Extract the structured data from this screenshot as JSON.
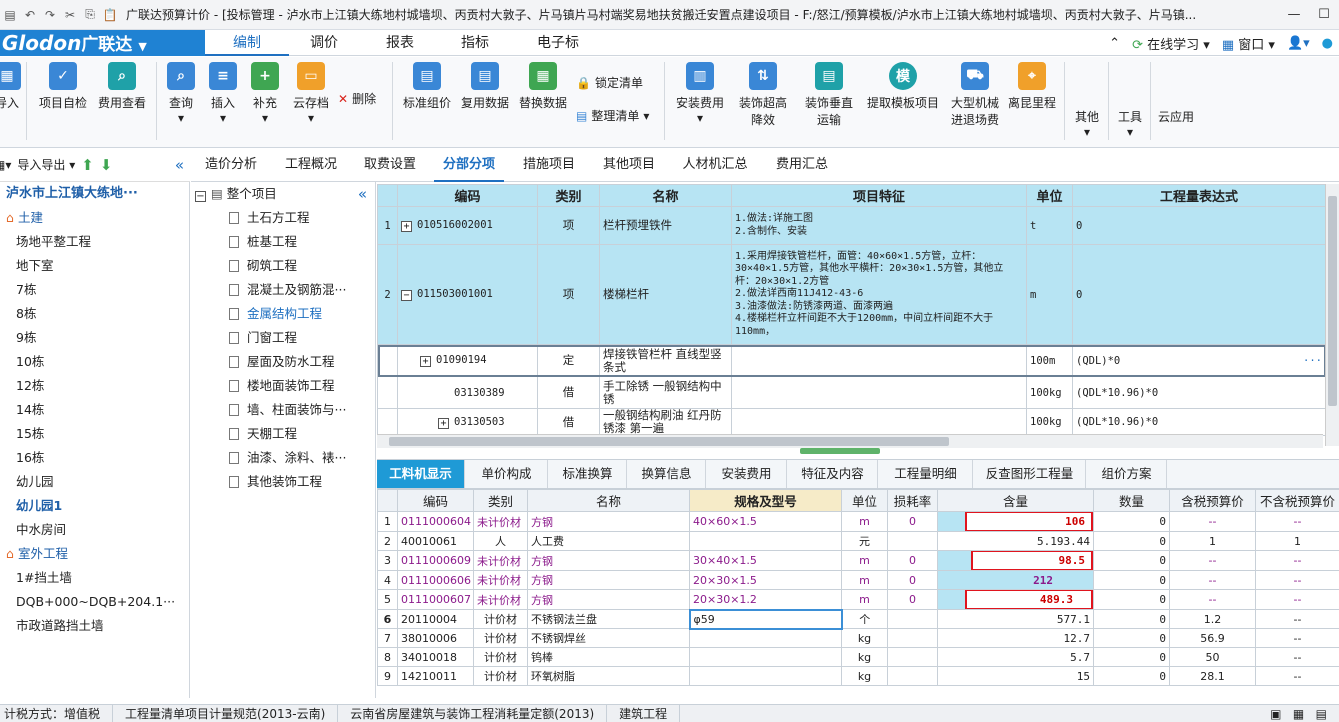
{
  "titlebar": {
    "title": "广联达预算计价 - [投标管理 - 泸水市上江镇大练地村城墙坝、丙贡村大敦子、片马镇片马村端奖易地扶贫搬迁安置点建设项目 - F:/怒江/预算模板/泸水市上江镇大练地村城墙坝、丙贡村大敦子、片马镇..."
  },
  "menu": {
    "logo": "Glodon",
    "logo_cn": "广联达",
    "tabs": [
      "编制",
      "调价",
      "报表",
      "指标",
      "电子标"
    ],
    "right": [
      "在线学习",
      "窗口"
    ]
  },
  "ribbon": {
    "buttons": [
      "导入",
      "项目自检",
      "费用查看",
      "查询",
      "插入",
      "补充",
      "云存档",
      "删除",
      "标准组价",
      "复用数据",
      "替换数据",
      "锁定清单",
      "整理清单",
      "安装费用",
      "装饰超高降效",
      "装饰垂直运输",
      "提取模板项目",
      "大型机械进退场费",
      "离昆里程",
      "其他",
      "工具",
      "云应用"
    ],
    "colors": {
      "blue": "#3a87d6",
      "green": "#3fa652",
      "orange": "#f0a02a",
      "teal": "#1fa1a8"
    }
  },
  "left": {
    "toolbar": [
      "导入导出"
    ],
    "items": [
      "泸水市上江镇大练地···",
      "土建",
      "场地平整工程",
      "地下室",
      "7栋",
      "8栋",
      "9栋",
      "10栋",
      "12栋",
      "14栋",
      "15栋",
      "16栋",
      "幼儿园",
      "幼儿园1",
      "中水房间",
      "室外工程",
      "1#挡土墙",
      "DQB+000~DQB+204.1···",
      "市政道路挡土墙"
    ]
  },
  "tabs": [
    "造价分析",
    "工程概况",
    "取费设置",
    "分部分项",
    "措施项目",
    "其他项目",
    "人材机汇总",
    "费用汇总"
  ],
  "tree": {
    "root": "整个项目",
    "items": [
      "土石方工程",
      "桩基工程",
      "砌筑工程",
      "混凝土及钢筋混···",
      "金属结构工程",
      "门窗工程",
      "屋面及防水工程",
      "楼地面装饰工程",
      "墙、柱面装饰与···",
      "天棚工程",
      "油漆、涂料、裱···",
      "其他装饰工程"
    ]
  },
  "topgrid": {
    "headers": [
      "编码",
      "类别",
      "名称",
      "项目特征",
      "单位",
      "工程量表达式"
    ],
    "rows": [
      {
        "no": "1",
        "code": "010516002001",
        "type": "项",
        "name": "栏杆预埋铁件",
        "feat": "1.做法:详施工图\n2.含制作、安装",
        "unit": "t",
        "expr": "0"
      },
      {
        "no": "2",
        "code": "011503001001",
        "type": "项",
        "name": "楼梯栏杆",
        "feat": "1.采用焊接铁管栏杆，面管：40×60×1.5方管，立杆：30×40×1.5方管，其他水平横杆：20×30×1.5方管，其他立杆：20×30×1.2方管\n2.做法详西南11J412-43-6\n3.油漆做法:防锈漆两道、面漆两遍\n4.楼梯栏杆立杆间距不大于1200mm，中间立杆间距不大于110mm，",
        "unit": "m",
        "expr": "0"
      },
      {
        "no": "",
        "code": "01090194",
        "type": "定",
        "name": "焊接铁管栏杆 直线型竖条式",
        "feat": "",
        "unit": "100m",
        "expr": "(QDL)*0"
      },
      {
        "no": "",
        "code": "03130389",
        "type": "借",
        "name": "手工除锈 一般钢结构中锈",
        "feat": "",
        "unit": "100kg",
        "expr": "(QDL*10.96)*0"
      },
      {
        "no": "",
        "code": "03130503",
        "type": "借",
        "name": "一般钢结构刷油 红丹防锈漆 第一遍",
        "feat": "",
        "unit": "100kg",
        "expr": "(QDL*10.96)*0"
      }
    ]
  },
  "bottabs": [
    "工料机显示",
    "单价构成",
    "标准换算",
    "换算信息",
    "安装费用",
    "特征及内容",
    "工程量明细",
    "反查图形工程量",
    "组价方案"
  ],
  "botgrid": {
    "headers": [
      "",
      "编码",
      "类别",
      "名称",
      "规格及型号",
      "单位",
      "损耗率",
      "含量",
      "数量",
      "含税预算价",
      "不含税预算价"
    ],
    "rows": [
      {
        "no": "1",
        "code": "0111000604",
        "type": "未计价材",
        "name": "方钢",
        "spec": "40×60×1.5",
        "unit": "m",
        "loss": "0",
        "qty": "106",
        "num": "0",
        "p1": "--",
        "p2": "--"
      },
      {
        "no": "2",
        "code": "40010061",
        "type": "人",
        "name": "人工费",
        "spec": "",
        "unit": "元",
        "loss": "",
        "qty": "5.193.44",
        "num": "0",
        "p1": "1",
        "p2": "1"
      },
      {
        "no": "3",
        "code": "0111000609",
        "type": "未计价材",
        "name": "方钢",
        "spec": "30×40×1.5",
        "unit": "m",
        "loss": "0",
        "qty": "98.5",
        "num": "0",
        "p1": "--",
        "p2": "--"
      },
      {
        "no": "4",
        "code": "0111000606",
        "type": "未计价材",
        "name": "方钢",
        "spec": "20×30×1.5",
        "unit": "m",
        "loss": "0",
        "qty": "212",
        "num": "0",
        "p1": "--",
        "p2": "--"
      },
      {
        "no": "5",
        "code": "0111000607",
        "type": "未计价材",
        "name": "方钢",
        "spec": "20×30×1.2",
        "unit": "m",
        "loss": "0",
        "qty": "489.3",
        "num": "0",
        "p1": "--",
        "p2": "--"
      },
      {
        "no": "6",
        "code": "20110004",
        "type": "计价材",
        "name": "不锈钢法兰盘",
        "spec": "φ59",
        "unit": "个",
        "loss": "",
        "qty": "577.1",
        "num": "0",
        "p1": "1.2",
        "p2": "--"
      },
      {
        "no": "7",
        "code": "38010006",
        "type": "计价材",
        "name": "不锈钢焊丝",
        "spec": "",
        "unit": "kg",
        "loss": "",
        "qty": "12.7",
        "num": "0",
        "p1": "56.9",
        "p2": "--"
      },
      {
        "no": "8",
        "code": "34010018",
        "type": "计价材",
        "name": "钨棒",
        "spec": "",
        "unit": "kg",
        "loss": "",
        "qty": "5.7",
        "num": "0",
        "p1": "50",
        "p2": "--"
      },
      {
        "no": "9",
        "code": "14210011",
        "type": "计价材",
        "name": "环氧树脂",
        "spec": "",
        "unit": "kg",
        "loss": "",
        "qty": "15",
        "num": "0",
        "p1": "28.1",
        "p2": "--"
      }
    ]
  },
  "status": [
    "计税方式：增值税",
    "工程量清单项目计量规范(2013-云南)",
    "云南省房屋建筑与装饰工程消耗量定额(2013)",
    "建筑工程"
  ]
}
